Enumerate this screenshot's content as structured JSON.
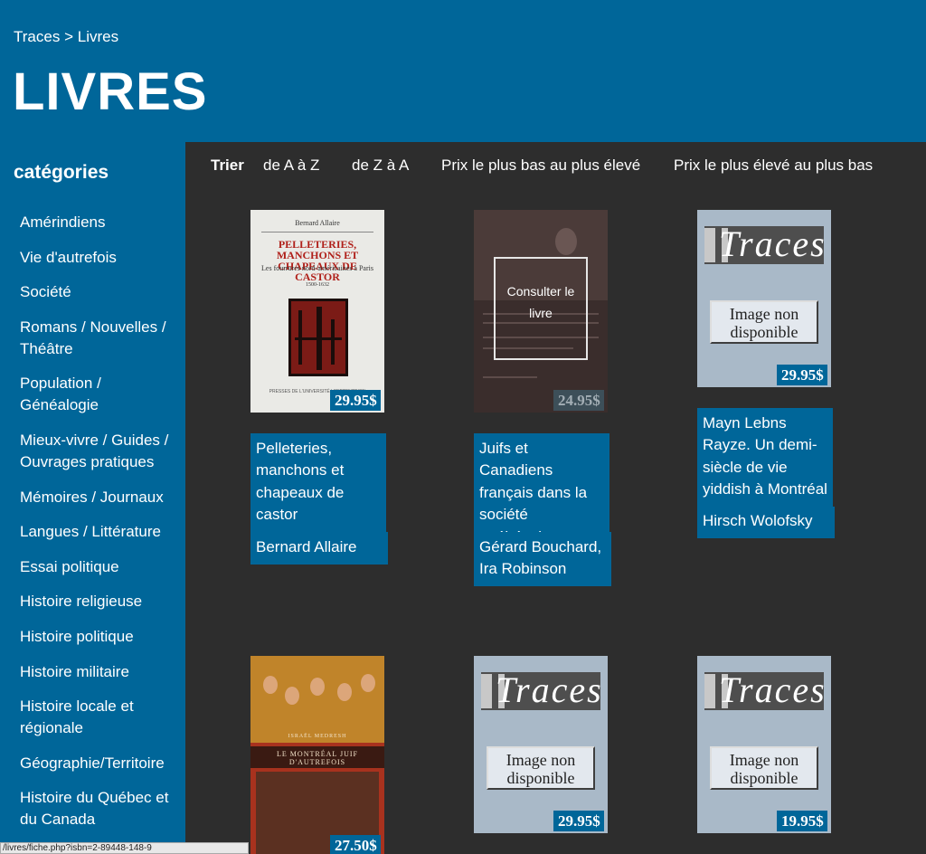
{
  "breadcrumb": {
    "home": "Traces",
    "separator": ">",
    "current": "Livres"
  },
  "page_title": "LIVRES",
  "sidebar": {
    "title": "catégories",
    "items": [
      "Amérindiens",
      "Vie d'autrefois",
      "Société",
      "Romans / Nouvelles / Théâtre",
      "Population / Généalogie",
      "Mieux-vivre / Guides / Ouvrages pratiques",
      "Mémoires / Journaux",
      "Langues / Littérature",
      "Essai politique",
      "Histoire religieuse",
      "Histoire politique",
      "Histoire militaire",
      "Histoire locale et régionale",
      "Géographie/Territoire",
      "Histoire du Québec et du Canada"
    ]
  },
  "sort": {
    "label": "Trier",
    "a_to_z": "de A à Z",
    "z_to_a": "de Z à A",
    "price_asc": "Prix le plus bas au plus élevé",
    "price_desc": "Prix le plus élevé au plus bas"
  },
  "books": [
    {
      "title": "Pelleteries, manchons et chapeaux de castor",
      "author": "Bernard Allaire",
      "price": "29.95$",
      "cover": {
        "author": "Bernard Allaire",
        "title": "PELLETERIES, MANCHONS ET CHAPEAUX DE CASTOR",
        "subtitle": "Les fourrures nord-américaines à Paris",
        "years": "1500-1632",
        "publisher": "PRESSES DE L'UNIVERSITÉ | SEPTENTRION"
      }
    },
    {
      "title": "Juifs et Canadiens français dans la société québécoise",
      "author": "Gérard Bouchard, Ira Robinson",
      "price": "24.95$",
      "hover": "Consulter le livre"
    },
    {
      "title": "Mayn Lebns Rayze. Un demi-siècle de vie yiddish à Montréal",
      "author": "Hirsch Wolofsky",
      "price": "29.95$",
      "placeholder": "Image non disponible",
      "logo": "Traces"
    },
    {
      "price": "27.50$",
      "cover": {
        "author": "ISRAËL MEDRESH",
        "title": "LE MONTRÉAL JUIF D'AUTREFOIS"
      }
    },
    {
      "price": "29.95$",
      "placeholder": "Image non disponible",
      "logo": "Traces"
    },
    {
      "price": "19.95$",
      "placeholder": "Image non disponible",
      "logo": "Traces"
    }
  ],
  "status_url": "/livres/fiche.php?isbn=2-89448-148-9",
  "colors": {
    "brand_blue": "#006699",
    "content_bg": "#2d2d2d"
  }
}
